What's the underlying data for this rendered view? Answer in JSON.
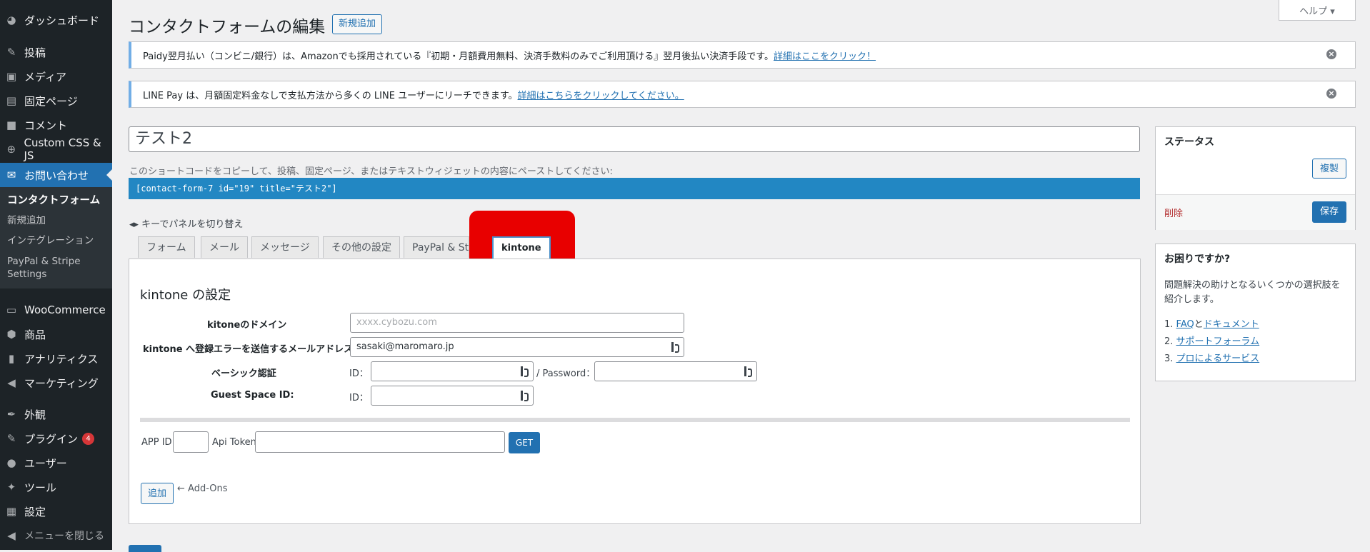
{
  "sidebar": {
    "items": [
      {
        "label": "ダッシュボード",
        "icon": "dashboard-icon",
        "glyph": "◕"
      },
      {
        "label": "投稿",
        "icon": "pin-icon",
        "glyph": "✎"
      },
      {
        "label": "メディア",
        "icon": "media-icon",
        "glyph": "▣"
      },
      {
        "label": "固定ページ",
        "icon": "page-icon",
        "glyph": "▤"
      },
      {
        "label": "コメント",
        "icon": "comment-icon",
        "glyph": "■"
      },
      {
        "label": "Custom CSS & JS",
        "icon": "plus-circle-icon",
        "glyph": "⊕"
      },
      {
        "label": "お問い合わせ",
        "icon": "mail-icon",
        "glyph": "✉"
      },
      {
        "label": "WooCommerce",
        "icon": "woocommerce-icon",
        "glyph": "▭"
      },
      {
        "label": "商品",
        "icon": "product-icon",
        "glyph": "⬢"
      },
      {
        "label": "アナリティクス",
        "icon": "analytics-icon",
        "glyph": "▮"
      },
      {
        "label": "マーケティング",
        "icon": "megaphone-icon",
        "glyph": "◀"
      },
      {
        "label": "外観",
        "icon": "appearance-icon",
        "glyph": "✒"
      },
      {
        "label": "プラグイン",
        "icon": "plugin-icon",
        "glyph": "✎",
        "badge": "4"
      },
      {
        "label": "ユーザー",
        "icon": "user-icon",
        "glyph": "●"
      },
      {
        "label": "ツール",
        "icon": "tools-icon",
        "glyph": "✦"
      },
      {
        "label": "設定",
        "icon": "settings-icon",
        "glyph": "▦"
      }
    ],
    "submenu": [
      "コンタクトフォーム",
      "新規追加",
      "インテグレーション",
      "PayPal & Stripe",
      "Settings"
    ],
    "collapse_label": "メニューを閉じる"
  },
  "header": {
    "help": "ヘルプ ▾",
    "title": "コンタクトフォームの編集",
    "add_new": "新規追加"
  },
  "notices": [
    {
      "text": "Paidy翌月払い（コンビニ/銀行）は、Amazonでも採用されている『初期・月額費用無料、決済手数料のみでご利用頂ける』翌月後払い決済手段です。",
      "link": "詳細はここをクリック！"
    },
    {
      "text": "LINE Pay は、月額固定料金なしで支払方法から多くの LINE ユーザーにリーチできます。",
      "link": "詳細はこちらをクリックしてください。"
    }
  ],
  "form": {
    "title": "テスト2",
    "shortcode_hint": "このショートコードをコピーして、投稿、固定ページ、またはテキストウィジェットの内容にペーストしてください:",
    "shortcode": "[contact-form-7 id=\"19\" title=\"テスト2\"]",
    "switch_hint": "◂▸ キーでパネルを切り替え",
    "tabs": [
      "フォーム",
      "メール",
      "メッセージ",
      "その他の設定",
      "PayPal & Stri",
      "kintone"
    ]
  },
  "kintone": {
    "heading": "kintone の設定",
    "domain_label": "kitoneのドメイン",
    "domain_placeholder": "xxxx.cybozu.com",
    "email_label": "kintone へ登録エラーを送信するメールアドレス",
    "email_value": "sasaki@maromaro.jp",
    "basic_auth_label": "ベーシック認証",
    "id_label": "ID：",
    "password_label": "/ Password：",
    "guest_space_label": "Guest Space ID:",
    "app_id_label": "APP ID:",
    "api_token_label": "Api Token:",
    "get_button": "GET",
    "add_button": "追加",
    "addons_note": "← Add-Ons"
  },
  "status_box": {
    "title": "ステータス",
    "duplicate": "複製",
    "delete": "削除",
    "save": "保存"
  },
  "help_box": {
    "title": "お困りですか?",
    "text": "問題解決の助けとなるいくつかの選択肢を紹介します。",
    "links": [
      {
        "num": "1.",
        "a": "FAQ",
        "mid": "と",
        "b": "ドキュメント"
      },
      {
        "num": "2.",
        "a": "サポートフォーラム"
      },
      {
        "num": "3.",
        "a": "プロによるサービス"
      }
    ]
  }
}
